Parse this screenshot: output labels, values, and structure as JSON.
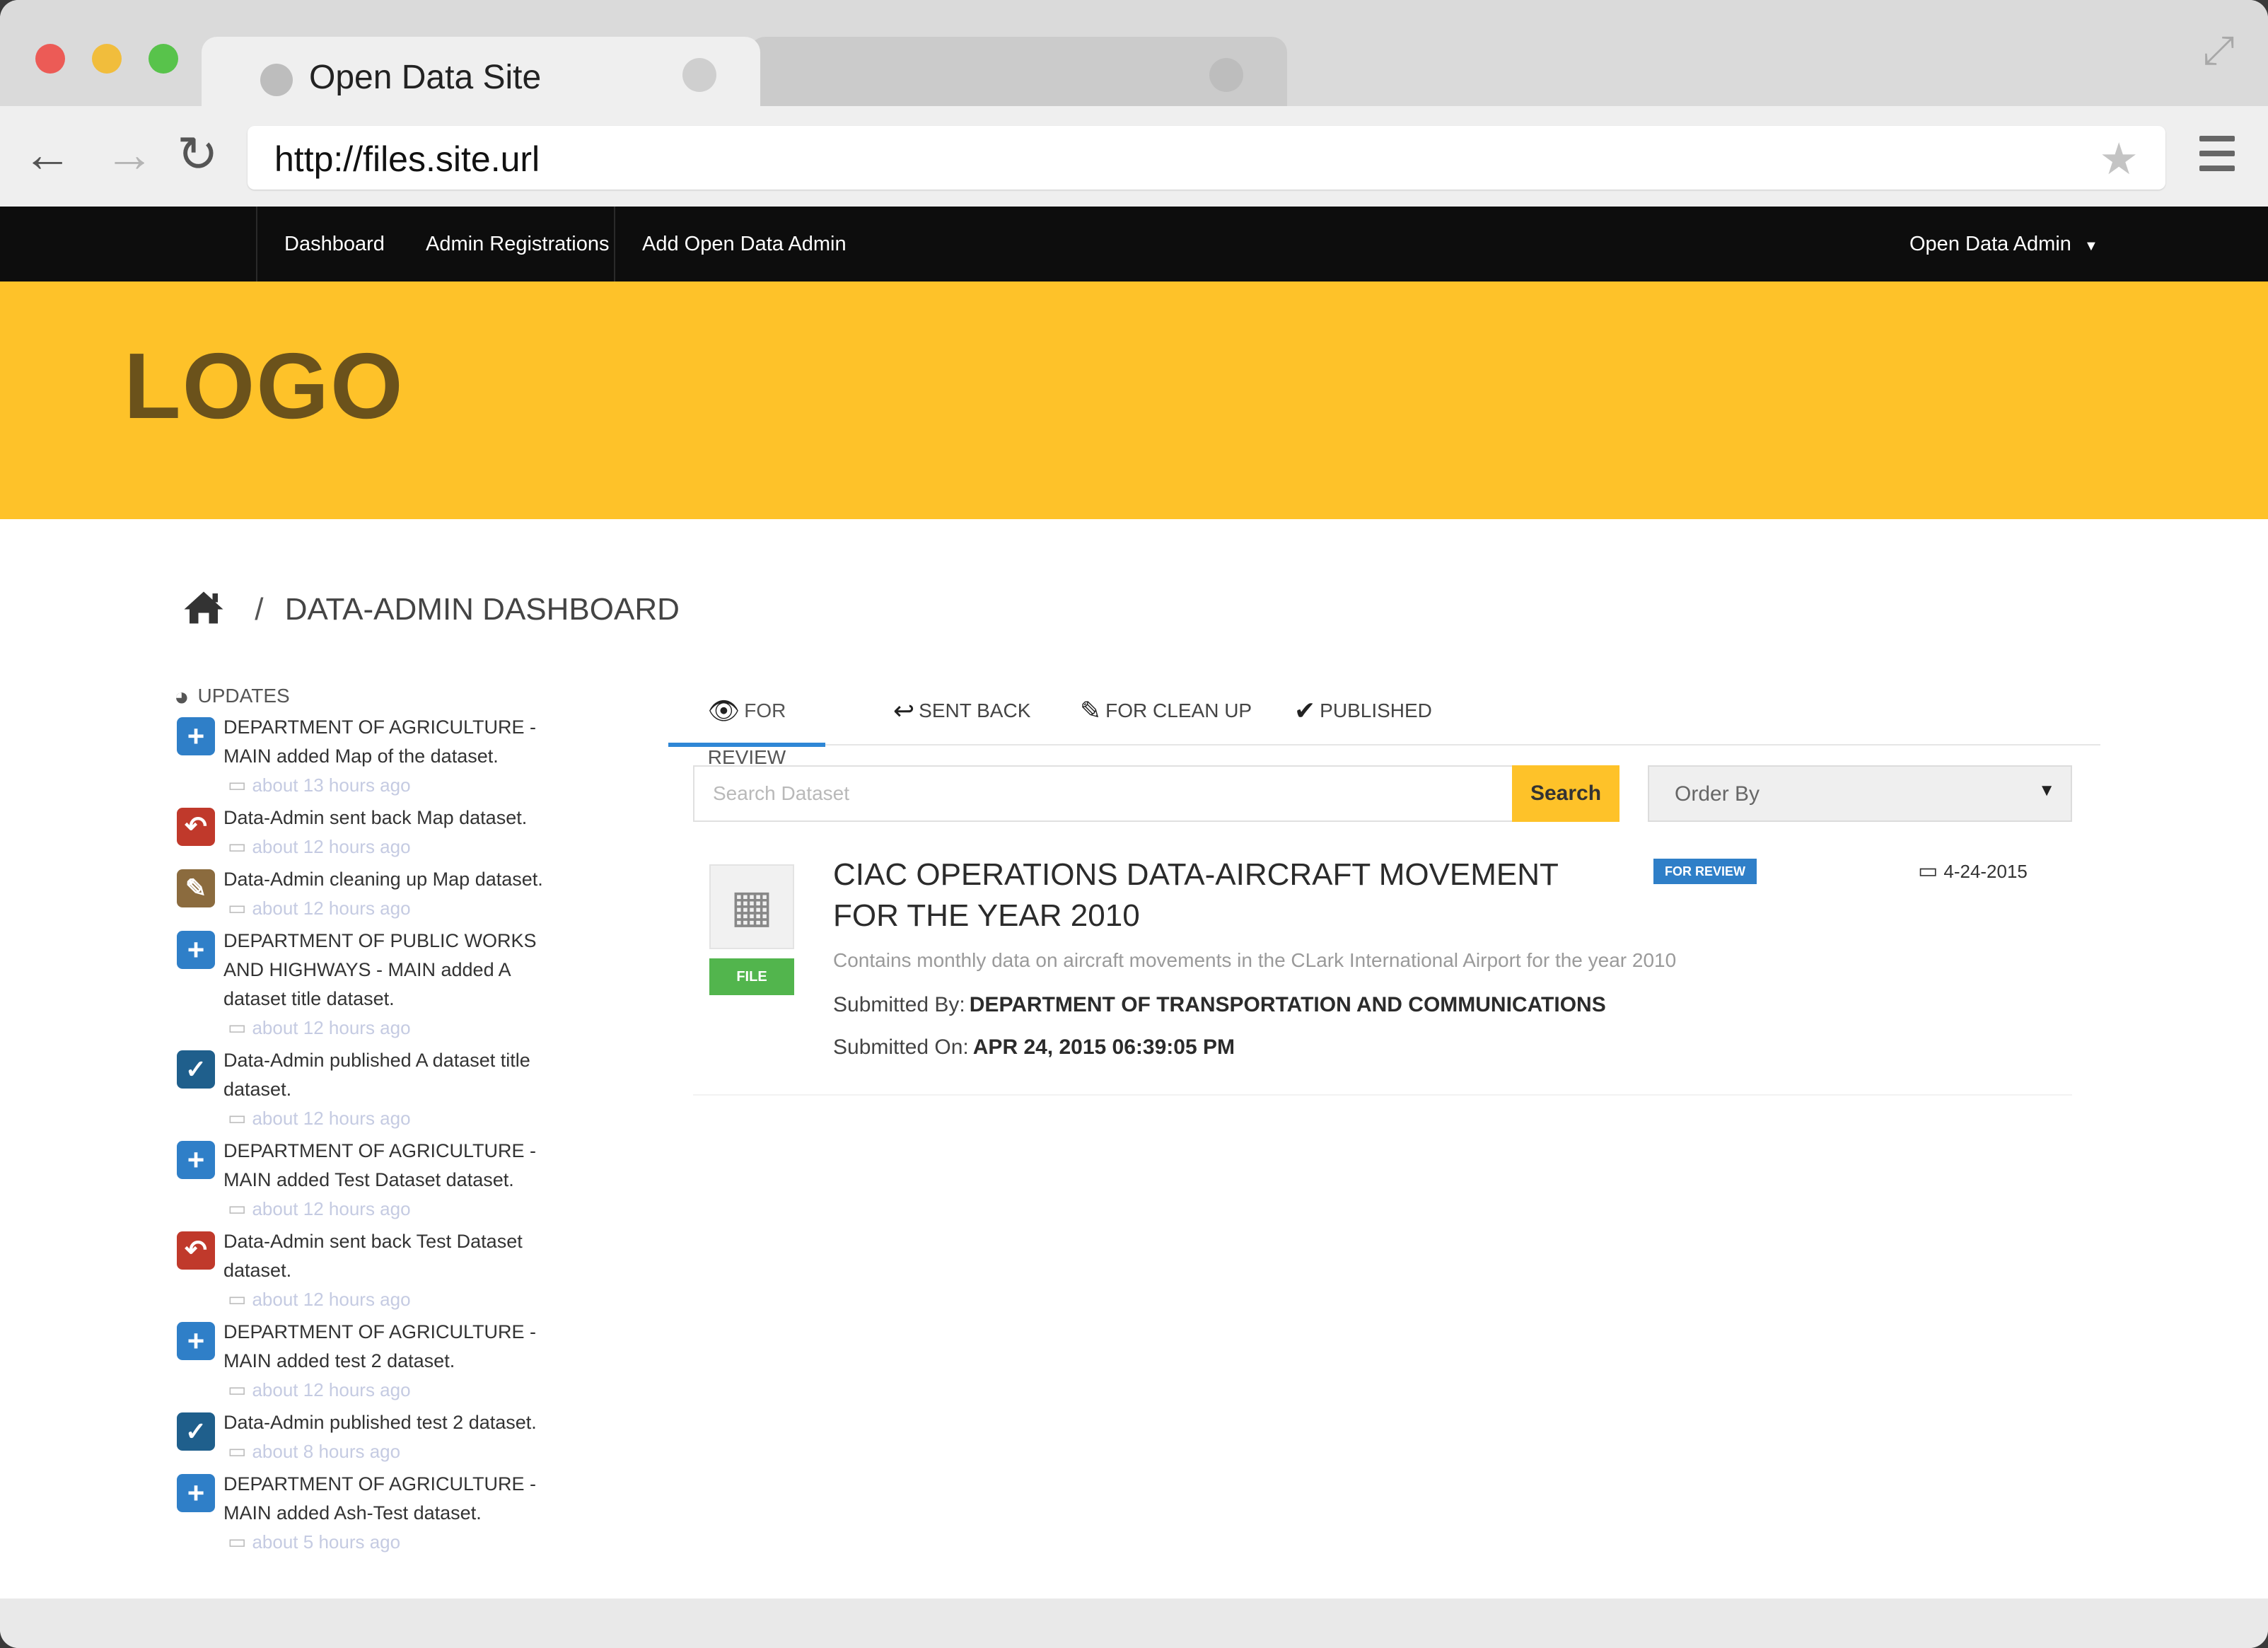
{
  "browser": {
    "tab_title": "Open Data Site",
    "url": "http://files.site.url"
  },
  "navbar": {
    "links": [
      "Dashboard",
      "Admin Registrations",
      "Add Open Data Admin"
    ],
    "user_menu": "Open Data Admin"
  },
  "banner": {
    "logo": "LOGO"
  },
  "breadcrumb": {
    "title": "DATA-ADMIN DASHBOARD"
  },
  "updates": {
    "title": "UPDATES",
    "items": [
      {
        "type": "add",
        "text": "DEPARTMENT OF AGRICULTURE - MAIN added Map of the dataset.",
        "time": "about 13 hours ago"
      },
      {
        "type": "back",
        "text": "Data-Admin sent back Map dataset.",
        "time": "about 12 hours ago"
      },
      {
        "type": "clean",
        "text": "Data-Admin cleaning up Map dataset.",
        "time": "about 12 hours ago"
      },
      {
        "type": "add",
        "text": "DEPARTMENT OF PUBLIC WORKS AND HIGHWAYS - MAIN added A dataset title dataset.",
        "time": "about 12 hours ago"
      },
      {
        "type": "pub",
        "text": "Data-Admin published A dataset title dataset.",
        "time": "about 12 hours ago"
      },
      {
        "type": "add",
        "text": "DEPARTMENT OF AGRICULTURE - MAIN added Test Dataset dataset.",
        "time": "about 12 hours ago"
      },
      {
        "type": "back",
        "text": "Data-Admin sent back Test Dataset dataset.",
        "time": "about 12 hours ago"
      },
      {
        "type": "add",
        "text": "DEPARTMENT OF AGRICULTURE - MAIN added test 2 dataset.",
        "time": "about 12 hours ago"
      },
      {
        "type": "pub",
        "text": "Data-Admin published test 2 dataset.",
        "time": "about 8 hours ago"
      },
      {
        "type": "add",
        "text": "DEPARTMENT OF AGRICULTURE - MAIN added Ash-Test dataset.",
        "time": "about 5 hours ago"
      }
    ]
  },
  "tabs": {
    "for_review": "FOR REVIEW",
    "sent_back": "SENT BACK",
    "for_clean_up": "FOR CLEAN UP",
    "published": "PUBLISHED"
  },
  "search": {
    "placeholder": "Search Dataset",
    "button": "Search",
    "order_by": "Order By"
  },
  "dataset": {
    "file_label": "FILE",
    "title": "CIAC OPERATIONS DATA-AIRCRAFT MOVEMENT FOR THE YEAR 2010",
    "badge": "FOR REVIEW",
    "date": "4-24-2015",
    "description": "Contains monthly data on aircraft movements in the CLark International Airport for the year 2010",
    "submitted_by_label": "Submitted By:",
    "submitted_by": "DEPARTMENT OF TRANSPORTATION AND COMMUNICATIONS",
    "submitted_on_label": "Submitted On:",
    "submitted_on": "APR 24, 2015 06:39:05 PM"
  },
  "colors": {
    "banner": "#fec229",
    "navbar": "#0d0d0d",
    "accent_blue": "#2f7fc8",
    "file_green": "#52b54d"
  }
}
